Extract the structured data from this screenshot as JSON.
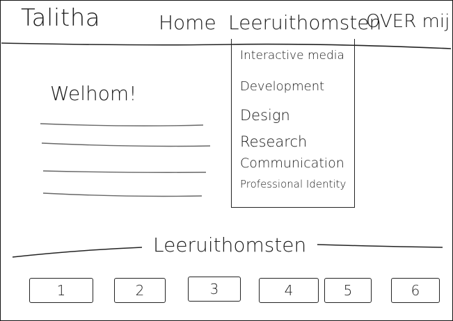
{
  "header": {
    "brand": "Talitha",
    "nav": [
      {
        "label": "Home"
      },
      {
        "label": "Leeruithomsten"
      },
      {
        "label": "OVER mij"
      }
    ]
  },
  "dropdown": {
    "items": [
      "Interactive media",
      "Development",
      "Design",
      "Research",
      "Communication",
      "Professional Identity"
    ]
  },
  "intro": {
    "heading": "Welhom!"
  },
  "section": {
    "title": "Leeruithomsten"
  },
  "pagination": {
    "buttons": [
      "1",
      "2",
      "3",
      "4",
      "5",
      "6"
    ]
  }
}
